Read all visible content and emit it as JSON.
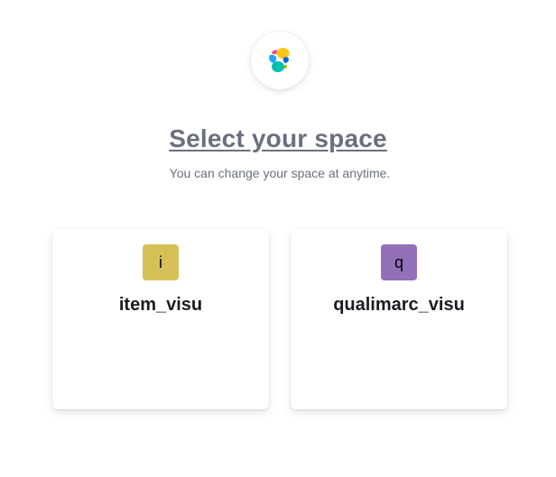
{
  "header": {
    "logo_icon": "elastic-logo-icon",
    "title": "Select your space",
    "subtitle": "You can change your space at anytime."
  },
  "spaces": [
    {
      "initial": "i",
      "name": "item_visu",
      "color": "#d6bf57"
    },
    {
      "initial": "q",
      "name": "qualimarc_visu",
      "color": "#9170b8"
    }
  ]
}
